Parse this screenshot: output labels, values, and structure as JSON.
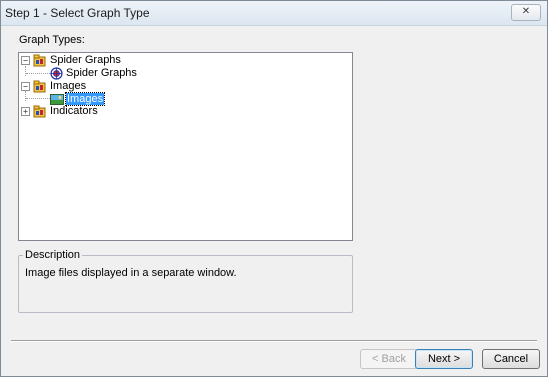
{
  "window": {
    "title": "Step 1 - Select Graph Type",
    "close_label": "✕"
  },
  "graph_types": {
    "label": "Graph Types:",
    "tree": [
      {
        "label": "Spider Graphs",
        "icon": "folder-icon",
        "expanded": true,
        "children": [
          {
            "label": "Spider Graphs",
            "icon": "spider-graph-icon"
          }
        ]
      },
      {
        "label": "Images",
        "icon": "folder-icon",
        "expanded": true,
        "children": [
          {
            "label": "Images",
            "icon": "image-icon",
            "selected": true
          }
        ]
      },
      {
        "label": "Indicators",
        "icon": "folder-icon",
        "expanded": false,
        "children": []
      }
    ]
  },
  "description": {
    "legend": "Description",
    "text": "Image files displayed in a separate window."
  },
  "buttons": {
    "back": "< Back",
    "next": "Next >",
    "cancel": "Cancel"
  },
  "colors": {
    "selection": "#3399ff",
    "dialog_bg": "#f0f0f0"
  }
}
